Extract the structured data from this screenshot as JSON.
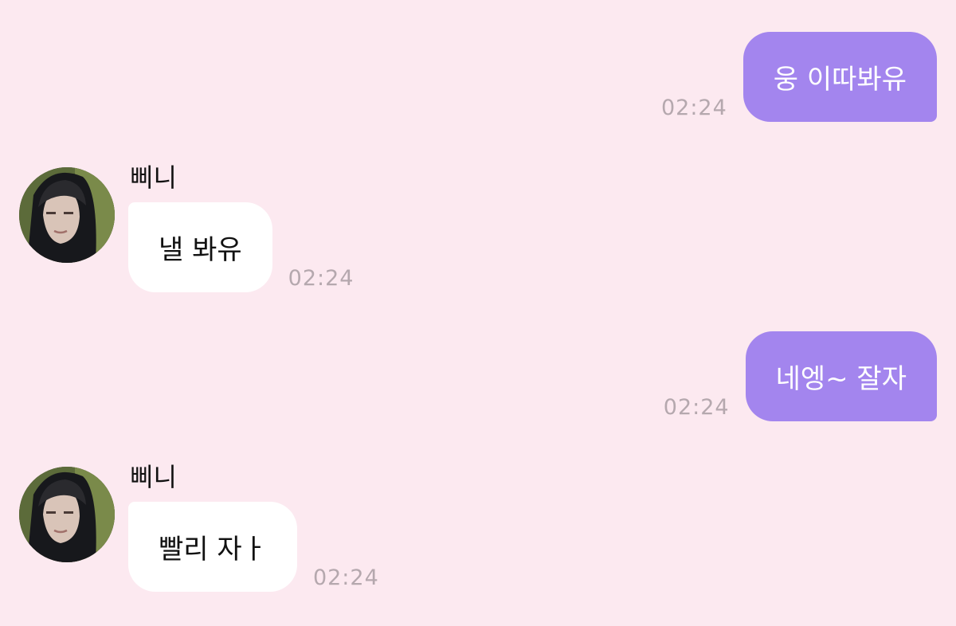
{
  "colors": {
    "background": "#FCE9F0",
    "outgoing_bubble": "#A385EE",
    "incoming_bubble": "#FFFFFF",
    "timestamp": "#B5A8AE"
  },
  "messages": [
    {
      "direction": "outgoing",
      "text": "웅 이따봐유",
      "time": "02:24"
    },
    {
      "direction": "incoming",
      "sender": "삐니",
      "avatar_icon": "profile-photo",
      "text": "낼 봐유",
      "time": "02:24"
    },
    {
      "direction": "outgoing",
      "text": "네엥~ 잘자",
      "time": "02:24"
    },
    {
      "direction": "incoming",
      "sender": "삐니",
      "avatar_icon": "profile-photo",
      "text": "빨리 자ㅏ",
      "time": "02:24"
    }
  ]
}
